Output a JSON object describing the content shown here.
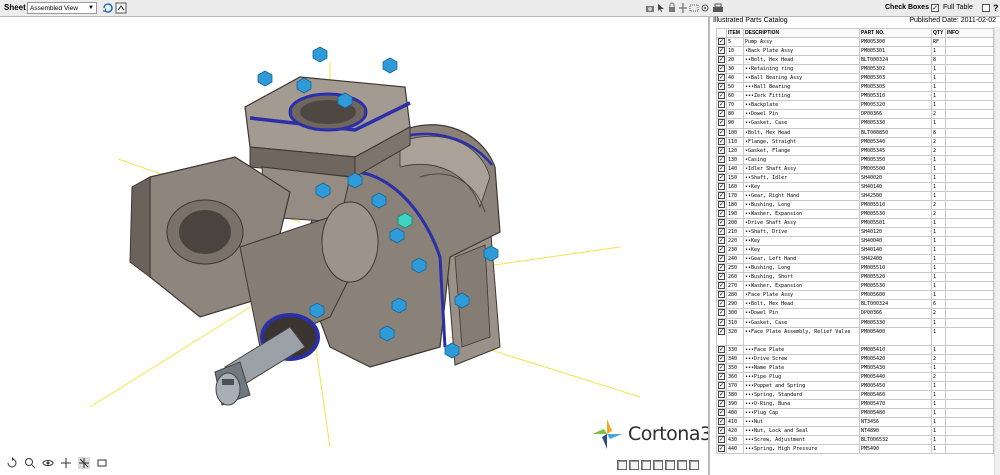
{
  "toolbar": {
    "sheet_label": "Sheet",
    "sheet_value": "Assembled View",
    "check_boxes_label": "Check Boxes",
    "full_table_label": "Full Table",
    "help_label": "?"
  },
  "viewport": {
    "logo_text": "Cortona3D"
  },
  "catalog": {
    "title": "Illustrated Parts Catalog",
    "published": "Published Date: 2011-02-02",
    "columns": [
      "ITEM",
      "DESCRIPTION",
      "PART NO.",
      "QTY",
      "INFO"
    ],
    "rows": [
      {
        "item": "5",
        "desc": "Pump Assy",
        "part": "PM005300",
        "qty": "RF"
      },
      {
        "item": "10",
        "desc": "•Back Plate Assy",
        "part": "PM005301",
        "qty": "1"
      },
      {
        "item": "20",
        "desc": "••Bolt, Hex Head",
        "part": "BLT000324",
        "qty": "8"
      },
      {
        "item": "30",
        "desc": "••Retaining ring",
        "part": "PM005302",
        "qty": "1"
      },
      {
        "item": "40",
        "desc": "••Ball Bearing Assy",
        "part": "PM005303",
        "qty": "1"
      },
      {
        "item": "50",
        "desc": "•••Ball Bearing",
        "part": "PM005305",
        "qty": "1"
      },
      {
        "item": "60",
        "desc": "•••Zerk Fitting",
        "part": "PM005310",
        "qty": "1"
      },
      {
        "item": "70",
        "desc": "••Backplate",
        "part": "PM005320",
        "qty": "1"
      },
      {
        "item": "80",
        "desc": "••Dowel Pin",
        "part": "DP00366",
        "qty": "2"
      },
      {
        "item": "90",
        "desc": "••Gasket, Case",
        "part": "PM005330",
        "qty": "1"
      },
      {
        "item": "100",
        "desc": "•Bolt, Hex Head",
        "part": "BLT000850",
        "qty": "8"
      },
      {
        "item": "110",
        "desc": "•Flange, Straight",
        "part": "PM005340",
        "qty": "2"
      },
      {
        "item": "120",
        "desc": "•Gasket, Flange",
        "part": "PM005345",
        "qty": "2"
      },
      {
        "item": "130",
        "desc": "•Casing",
        "part": "PM005350",
        "qty": "1"
      },
      {
        "item": "140",
        "desc": "•Idler Shaft Assy",
        "part": "PM005500",
        "qty": "1"
      },
      {
        "item": "150",
        "desc": "••Shaft, Idler",
        "part": "SH40020",
        "qty": "1"
      },
      {
        "item": "160",
        "desc": "••Key",
        "part": "SH40140",
        "qty": "1"
      },
      {
        "item": "170",
        "desc": "••Gear, Right Hand",
        "part": "SH42500",
        "qty": "1"
      },
      {
        "item": "180",
        "desc": "••Bushing, Long",
        "part": "PM005510",
        "qty": "2"
      },
      {
        "item": "190",
        "desc": "••Washer, Expansion",
        "part": "PM005530",
        "qty": "2"
      },
      {
        "item": "200",
        "desc": "•Drive Shaft Assy",
        "part": "PM005501",
        "qty": "1"
      },
      {
        "item": "210",
        "desc": "••Shaft, Drive",
        "part": "SH40120",
        "qty": "1"
      },
      {
        "item": "220",
        "desc": "••Key",
        "part": "SH40040",
        "qty": "1"
      },
      {
        "item": "230",
        "desc": "••Key",
        "part": "SH40140",
        "qty": "1"
      },
      {
        "item": "240",
        "desc": "••Gear, Left Hand",
        "part": "SH42400",
        "qty": "1"
      },
      {
        "item": "250",
        "desc": "••Bushing, Long",
        "part": "PM005510",
        "qty": "1"
      },
      {
        "item": "260",
        "desc": "••Bushing, Short",
        "part": "PM005520",
        "qty": "1"
      },
      {
        "item": "270",
        "desc": "••Washer, Expansion",
        "part": "PM005530",
        "qty": "1"
      },
      {
        "item": "280",
        "desc": "•Face Plate Assy",
        "part": "PM005600",
        "qty": "1"
      },
      {
        "item": "290",
        "desc": "••Bolt, Hex Head",
        "part": "BLT000324",
        "qty": "6"
      },
      {
        "item": "300",
        "desc": "••Dowel Pin",
        "part": "DP00366",
        "qty": "2"
      },
      {
        "item": "310",
        "desc": "••Gasket, Case",
        "part": "PM005330",
        "qty": "1"
      },
      {
        "item": "320",
        "desc": "••Face Plate Assembly, Relief Valve",
        "part": "PM005400",
        "qty": "1",
        "tall": true
      },
      {
        "item": "330",
        "desc": "•••Face Plate",
        "part": "PM005410",
        "qty": "1"
      },
      {
        "item": "340",
        "desc": "•••Drive Screw",
        "part": "PM005420",
        "qty": "2"
      },
      {
        "item": "350",
        "desc": "•••Name Plate",
        "part": "PM005430",
        "qty": "1"
      },
      {
        "item": "360",
        "desc": "•••Pipe Plug",
        "part": "PM005440",
        "qty": "2"
      },
      {
        "item": "370",
        "desc": "•••Poppet and Spring",
        "part": "PM005450",
        "qty": "1"
      },
      {
        "item": "380",
        "desc": "•••Spring, Standard",
        "part": "PM005460",
        "qty": "1"
      },
      {
        "item": "390",
        "desc": "•••O-Ring, Buna",
        "part": "PM005470",
        "qty": "1"
      },
      {
        "item": "400",
        "desc": "•••Plug Cap",
        "part": "PM005480",
        "qty": "1"
      },
      {
        "item": "410",
        "desc": "•••Nut",
        "part": "NT3456",
        "qty": "1"
      },
      {
        "item": "420",
        "desc": "•••Nut, Lock and Seal",
        "part": "NT4890",
        "qty": "1"
      },
      {
        "item": "430",
        "desc": "•••Screw, Adjustment",
        "part": "BLT006532",
        "qty": "1"
      },
      {
        "item": "440",
        "desc": "•••Spring, High Pressure",
        "part": "PM5490",
        "qty": "1"
      }
    ]
  },
  "colors": {
    "metal": "#8a8178",
    "metal_light": "#b6ada3",
    "metal_dark": "#5f5750",
    "bolt": "#2f9ad8",
    "gasket": "#2b2fa8",
    "axis": "#f2e84c"
  },
  "icons": [
    "refresh-icon",
    "print-icon",
    "pan-icon",
    "zoom-icon",
    "rotate-icon",
    "select-icon",
    "fit-icon",
    "printer-icon"
  ]
}
